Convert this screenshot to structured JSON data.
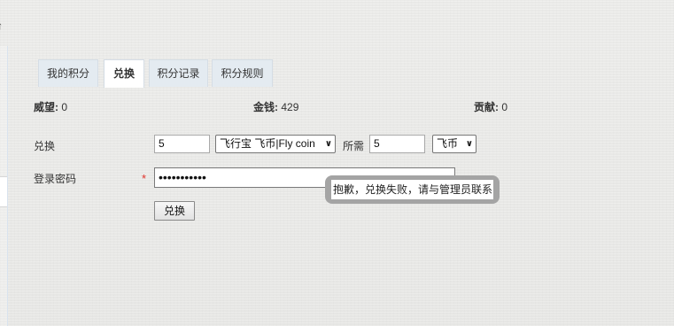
{
  "top_icon": "arrow-icon",
  "tabs": [
    {
      "label": "我的积分",
      "active": false
    },
    {
      "label": "兑换",
      "active": true
    },
    {
      "label": "积分记录",
      "active": false
    },
    {
      "label": "积分规则",
      "active": false
    }
  ],
  "stats": {
    "prestige_label": "威望:",
    "prestige_value": "0",
    "money_label": "金钱:",
    "money_value": "429",
    "contribution_label": "贡献:",
    "contribution_value": "0"
  },
  "form": {
    "exchange_label": "兑换",
    "amount_value": "5",
    "currency_selected": "飞行宝 飞币|Fly coin",
    "need_label": "所需",
    "need_value": "5",
    "unit_selected": "飞币",
    "password_label": "登录密码",
    "required_mark": "*",
    "password_mask": "•••••••••••",
    "submit_label": "兑换"
  },
  "tooltip": {
    "message": "抱歉，兑换失败，请与管理员联系"
  }
}
